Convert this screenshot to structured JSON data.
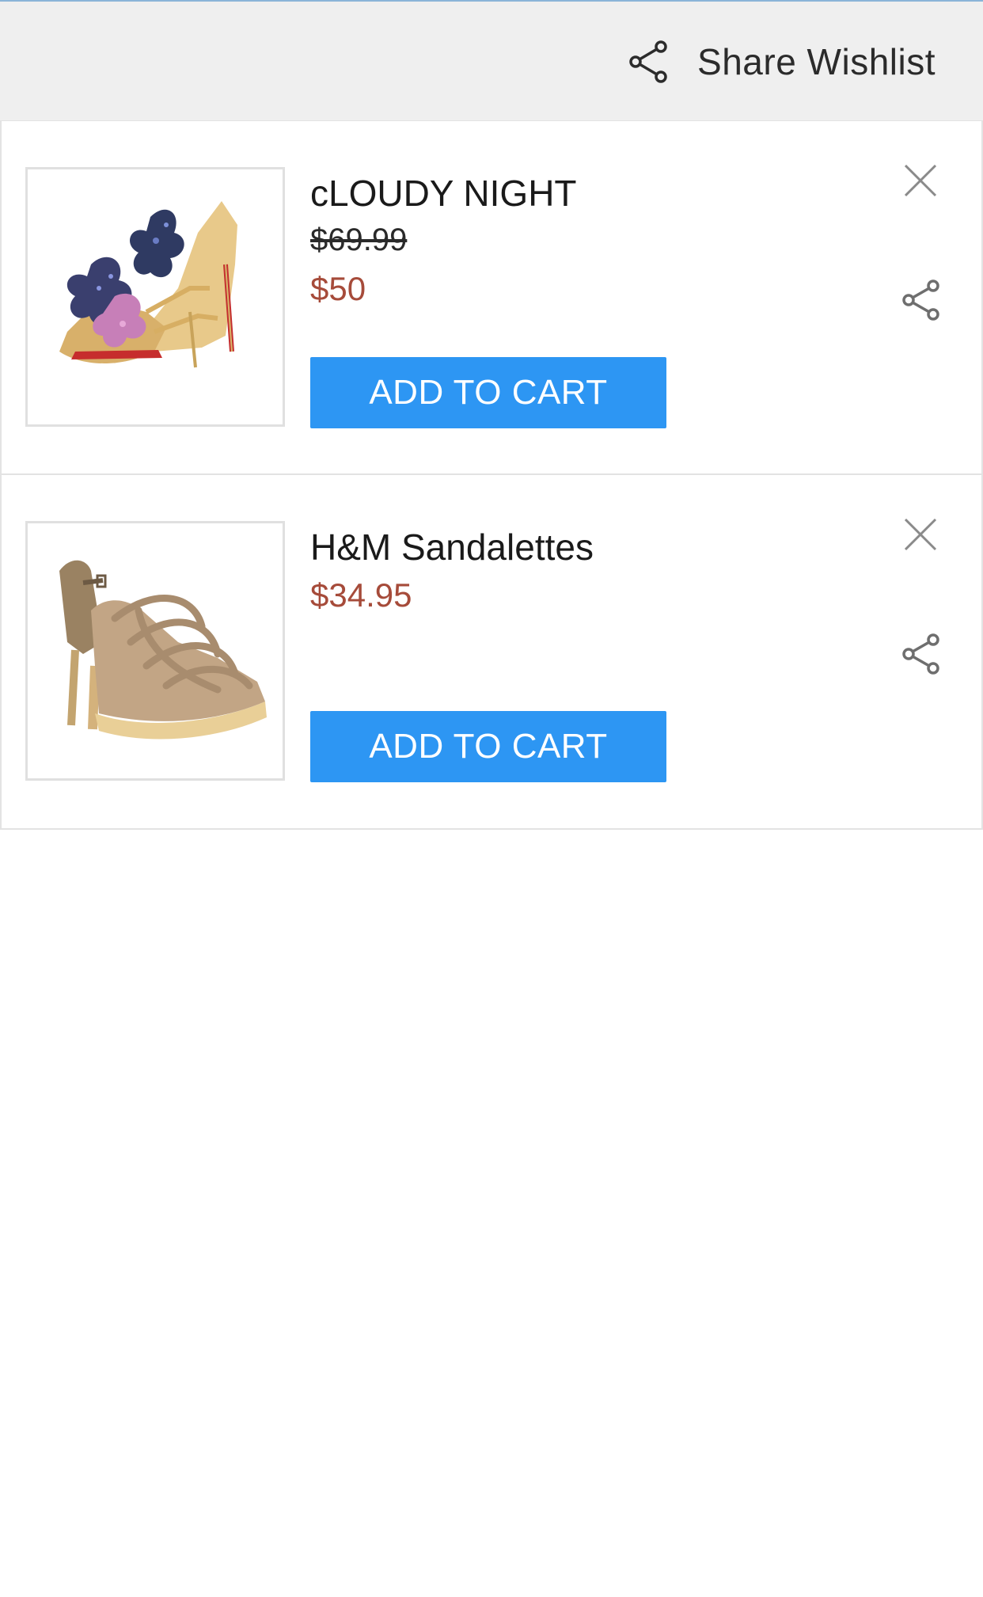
{
  "header": {
    "share_wishlist_label": "Share Wishlist",
    "share_icon": "share-icon"
  },
  "items": [
    {
      "name": "cLOUDY NIGHT",
      "original_price": "$69.99",
      "price": "$50",
      "add_to_cart_label": "ADD TO CART",
      "image": "gold-glitter-heel-sandal",
      "close_icon": "close-icon",
      "share_icon": "share-icon"
    },
    {
      "name": "H&M Sandalettes",
      "price": "$34.95",
      "add_to_cart_label": "ADD TO CART",
      "image": "beige-strappy-platform-sandal",
      "close_icon": "close-icon",
      "share_icon": "share-icon"
    }
  ],
  "colors": {
    "header_background": "#efefef",
    "button": "#2d96f3",
    "price": "#a64b3a"
  }
}
